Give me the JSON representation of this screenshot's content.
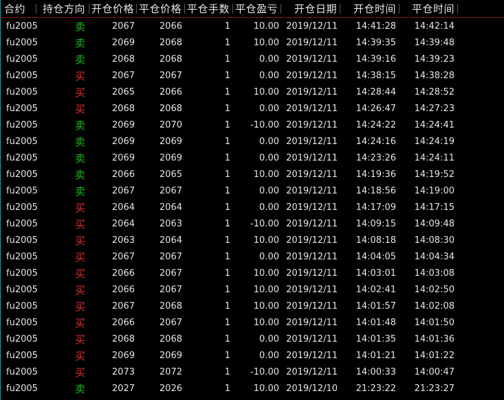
{
  "colors": {
    "background": "#000000",
    "text": "#e6e6e6",
    "sell": "#1fb51f",
    "buy": "#e03030",
    "header_rule": "#8a1414",
    "left_border": "#1fa3a3"
  },
  "columns": [
    "合约",
    "持仓方向",
    "开仓价格",
    "平仓价格",
    "平仓手数",
    "平仓盈亏",
    "开仓日期",
    "开仓时间",
    "平仓时间"
  ],
  "rows": [
    {
      "contract": "fu2005",
      "direction": "卖",
      "side": "sell",
      "open_price": "2067",
      "close_price": "2066",
      "lots": "1",
      "pnl": "10.00",
      "open_date": "2019/12/11",
      "open_time": "14:41:28",
      "close_time": "14:42:14"
    },
    {
      "contract": "fu2005",
      "direction": "卖",
      "side": "sell",
      "open_price": "2069",
      "close_price": "2068",
      "lots": "1",
      "pnl": "10.00",
      "open_date": "2019/12/11",
      "open_time": "14:39:35",
      "close_time": "14:39:48"
    },
    {
      "contract": "fu2005",
      "direction": "卖",
      "side": "sell",
      "open_price": "2068",
      "close_price": "2068",
      "lots": "1",
      "pnl": "0.00",
      "open_date": "2019/12/11",
      "open_time": "14:39:16",
      "close_time": "14:39:23"
    },
    {
      "contract": "fu2005",
      "direction": "买",
      "side": "buy",
      "open_price": "2067",
      "close_price": "2067",
      "lots": "1",
      "pnl": "0.00",
      "open_date": "2019/12/11",
      "open_time": "14:38:15",
      "close_time": "14:38:28"
    },
    {
      "contract": "fu2005",
      "direction": "买",
      "side": "buy",
      "open_price": "2065",
      "close_price": "2066",
      "lots": "1",
      "pnl": "10.00",
      "open_date": "2019/12/11",
      "open_time": "14:28:44",
      "close_time": "14:28:52"
    },
    {
      "contract": "fu2005",
      "direction": "买",
      "side": "buy",
      "open_price": "2068",
      "close_price": "2068",
      "lots": "1",
      "pnl": "0.00",
      "open_date": "2019/12/11",
      "open_time": "14:26:47",
      "close_time": "14:27:23"
    },
    {
      "contract": "fu2005",
      "direction": "卖",
      "side": "sell",
      "open_price": "2069",
      "close_price": "2070",
      "lots": "1",
      "pnl": "-10.00",
      "open_date": "2019/12/11",
      "open_time": "14:24:22",
      "close_time": "14:24:41"
    },
    {
      "contract": "fu2005",
      "direction": "卖",
      "side": "sell",
      "open_price": "2069",
      "close_price": "2069",
      "lots": "1",
      "pnl": "0.00",
      "open_date": "2019/12/11",
      "open_time": "14:24:16",
      "close_time": "14:24:19"
    },
    {
      "contract": "fu2005",
      "direction": "卖",
      "side": "sell",
      "open_price": "2069",
      "close_price": "2069",
      "lots": "1",
      "pnl": "0.00",
      "open_date": "2019/12/11",
      "open_time": "14:23:26",
      "close_time": "14:24:11"
    },
    {
      "contract": "fu2005",
      "direction": "卖",
      "side": "sell",
      "open_price": "2066",
      "close_price": "2065",
      "lots": "1",
      "pnl": "10.00",
      "open_date": "2019/12/11",
      "open_time": "14:19:36",
      "close_time": "14:19:52"
    },
    {
      "contract": "fu2005",
      "direction": "卖",
      "side": "sell",
      "open_price": "2067",
      "close_price": "2067",
      "lots": "1",
      "pnl": "0.00",
      "open_date": "2019/12/11",
      "open_time": "14:18:56",
      "close_time": "14:19:00"
    },
    {
      "contract": "fu2005",
      "direction": "买",
      "side": "buy",
      "open_price": "2064",
      "close_price": "2064",
      "lots": "1",
      "pnl": "0.00",
      "open_date": "2019/12/11",
      "open_time": "14:17:09",
      "close_time": "14:17:15"
    },
    {
      "contract": "fu2005",
      "direction": "买",
      "side": "buy",
      "open_price": "2064",
      "close_price": "2063",
      "lots": "1",
      "pnl": "-10.00",
      "open_date": "2019/12/11",
      "open_time": "14:09:15",
      "close_time": "14:09:48"
    },
    {
      "contract": "fu2005",
      "direction": "买",
      "side": "buy",
      "open_price": "2063",
      "close_price": "2064",
      "lots": "1",
      "pnl": "10.00",
      "open_date": "2019/12/11",
      "open_time": "14:08:18",
      "close_time": "14:08:30"
    },
    {
      "contract": "fu2005",
      "direction": "买",
      "side": "buy",
      "open_price": "2067",
      "close_price": "2067",
      "lots": "1",
      "pnl": "0.00",
      "open_date": "2019/12/11",
      "open_time": "14:04:05",
      "close_time": "14:04:34"
    },
    {
      "contract": "fu2005",
      "direction": "买",
      "side": "buy",
      "open_price": "2066",
      "close_price": "2067",
      "lots": "1",
      "pnl": "10.00",
      "open_date": "2019/12/11",
      "open_time": "14:03:01",
      "close_time": "14:03:08"
    },
    {
      "contract": "fu2005",
      "direction": "买",
      "side": "buy",
      "open_price": "2066",
      "close_price": "2067",
      "lots": "1",
      "pnl": "10.00",
      "open_date": "2019/12/11",
      "open_time": "14:02:41",
      "close_time": "14:02:50"
    },
    {
      "contract": "fu2005",
      "direction": "买",
      "side": "buy",
      "open_price": "2067",
      "close_price": "2068",
      "lots": "1",
      "pnl": "10.00",
      "open_date": "2019/12/11",
      "open_time": "14:01:57",
      "close_time": "14:02:08"
    },
    {
      "contract": "fu2005",
      "direction": "买",
      "side": "buy",
      "open_price": "2066",
      "close_price": "2067",
      "lots": "1",
      "pnl": "10.00",
      "open_date": "2019/12/11",
      "open_time": "14:01:48",
      "close_time": "14:01:50"
    },
    {
      "contract": "fu2005",
      "direction": "买",
      "side": "buy",
      "open_price": "2068",
      "close_price": "2068",
      "lots": "1",
      "pnl": "0.00",
      "open_date": "2019/12/11",
      "open_time": "14:01:35",
      "close_time": "14:01:36"
    },
    {
      "contract": "fu2005",
      "direction": "买",
      "side": "buy",
      "open_price": "2069",
      "close_price": "2069",
      "lots": "1",
      "pnl": "0.00",
      "open_date": "2019/12/11",
      "open_time": "14:01:21",
      "close_time": "14:01:22"
    },
    {
      "contract": "fu2005",
      "direction": "买",
      "side": "buy",
      "open_price": "2073",
      "close_price": "2072",
      "lots": "1",
      "pnl": "-10.00",
      "open_date": "2019/12/11",
      "open_time": "14:00:33",
      "close_time": "14:00:47"
    },
    {
      "contract": "fu2005",
      "direction": "卖",
      "side": "sell",
      "open_price": "2027",
      "close_price": "2026",
      "lots": "1",
      "pnl": "10.00",
      "open_date": "2019/12/10",
      "open_time": "21:23:22",
      "close_time": "21:23:27"
    }
  ]
}
